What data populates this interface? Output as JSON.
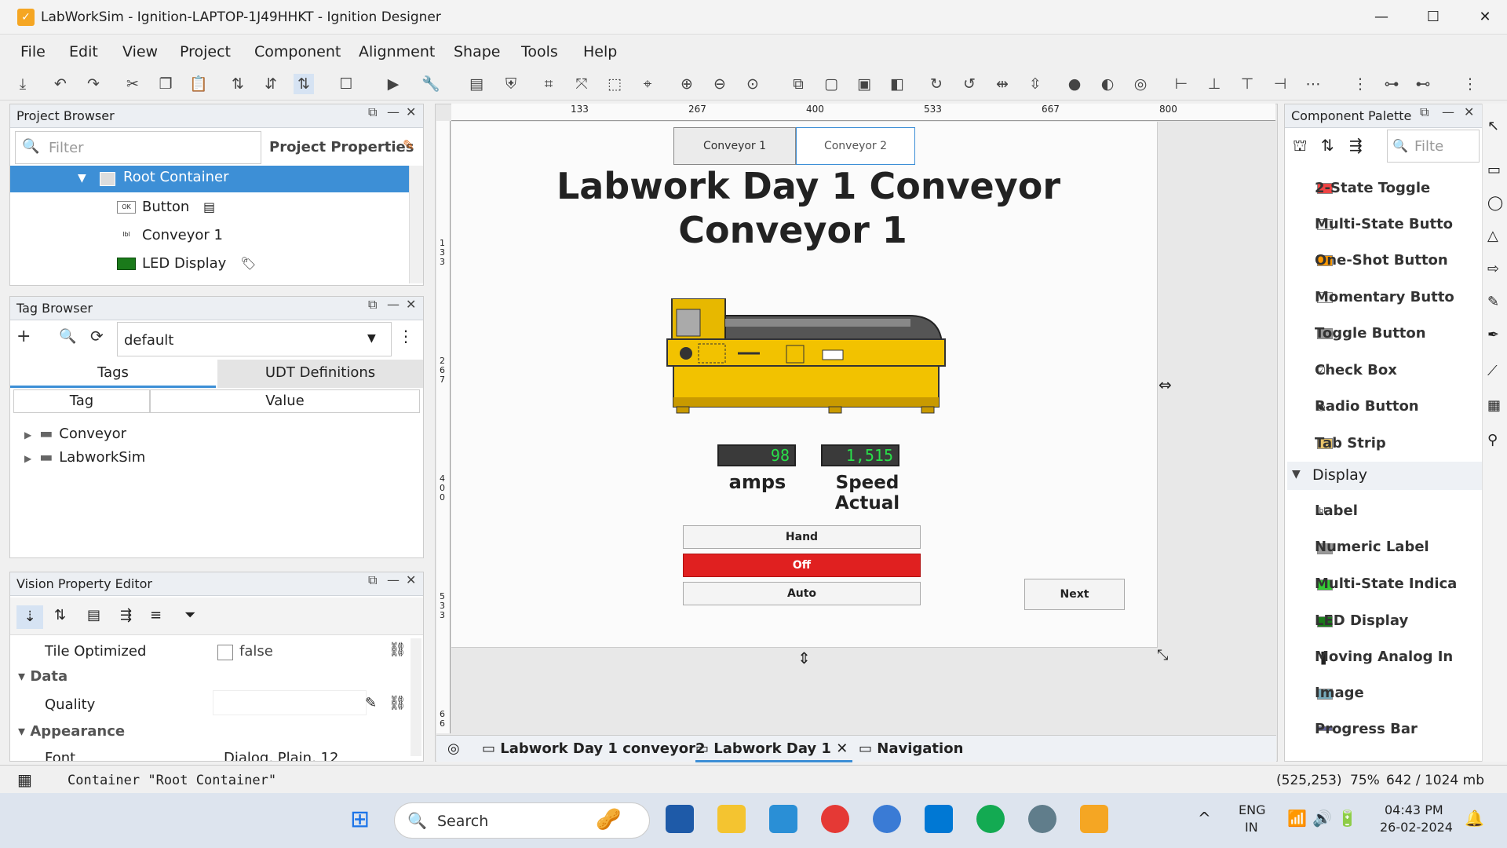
{
  "window": {
    "title": "LabWorkSim - Ignition-LAPTOP-1J49HHKT - Ignition Designer",
    "minimize": "—",
    "maximize": "☐",
    "close": "✕"
  },
  "menu": [
    "File",
    "Edit",
    "View",
    "Project",
    "Component",
    "Alignment",
    "Shape",
    "Tools",
    "Help"
  ],
  "project_browser": {
    "title": "Project Browser",
    "filter_placeholder": "Filter",
    "project_properties": "Project Properties",
    "tree": [
      {
        "label": "Root Container",
        "icon": "container-icon"
      },
      {
        "label": "Button",
        "icon": "button-icon"
      },
      {
        "label": "Conveyor 1",
        "icon": "label-icon"
      },
      {
        "label": "LED Display",
        "icon": "led-icon"
      }
    ]
  },
  "tag_browser": {
    "title": "Tag Browser",
    "provider": "default",
    "tabs": [
      "Tags",
      "UDT Definitions"
    ],
    "columns": [
      "Tag",
      "Value"
    ],
    "rows": [
      "Conveyor",
      "LabworkSim"
    ]
  },
  "property_editor": {
    "title": "Vision Property Editor",
    "rows": [
      {
        "name": "Tile Optimized",
        "value": "false"
      },
      {
        "section": "Data"
      },
      {
        "name": "Quality",
        "value": ""
      },
      {
        "section": "Appearance"
      },
      {
        "name": "Font",
        "value": "Dialog, Plain, 12"
      }
    ]
  },
  "ruler": {
    "ticks": [
      "133",
      "267",
      "400",
      "533",
      "667",
      "800"
    ],
    "vticks": [
      "1 3 3",
      "2 6 7",
      "4 0 0",
      "5 3 3",
      "6 6"
    ]
  },
  "window_canvas": {
    "tabs": [
      "Conveyor 1",
      "Conveyor 2"
    ],
    "heading_line1": "Labwork Day 1 Conveyor",
    "heading_line2": "Conveyor 1",
    "amps_value": "98",
    "speed_value": "1,515",
    "amps_label": "amps",
    "speed_label": "Speed Actual",
    "hand": "Hand",
    "off": "Off",
    "auto": "Auto",
    "next": "Next"
  },
  "doc_tabs": [
    "Labwork Day 1 conveyor2",
    "Labwork Day 1",
    "Navigation"
  ],
  "palette": {
    "title": "Component Palette",
    "filter_placeholder": "Filte",
    "items": [
      "2-State Toggle",
      "Multi-State Butto",
      "One-Shot Button",
      "Momentary Butto",
      "Toggle Button",
      "Check Box",
      "Radio Button",
      "Tab Strip"
    ],
    "section": "Display",
    "display_items": [
      "Label",
      "Numeric Label",
      "Multi-State Indica",
      "LED Display",
      "Moving Analog In",
      "Image",
      "Progress Bar"
    ]
  },
  "status": {
    "selection": "Container \"Root Container\"",
    "coords": "(525,253)",
    "zoom": "75%",
    "memory": "642 / 1024 mb"
  },
  "taskbar": {
    "search": "Search",
    "lang1": "ENG",
    "lang2": "IN",
    "time": "04:43 PM",
    "date": "26-02-2024"
  },
  "colors": {
    "accent": "#1f6fd1",
    "off_red": "#e02020",
    "led_green": "#29e04a",
    "conveyor_yellow": "#f2c200"
  }
}
